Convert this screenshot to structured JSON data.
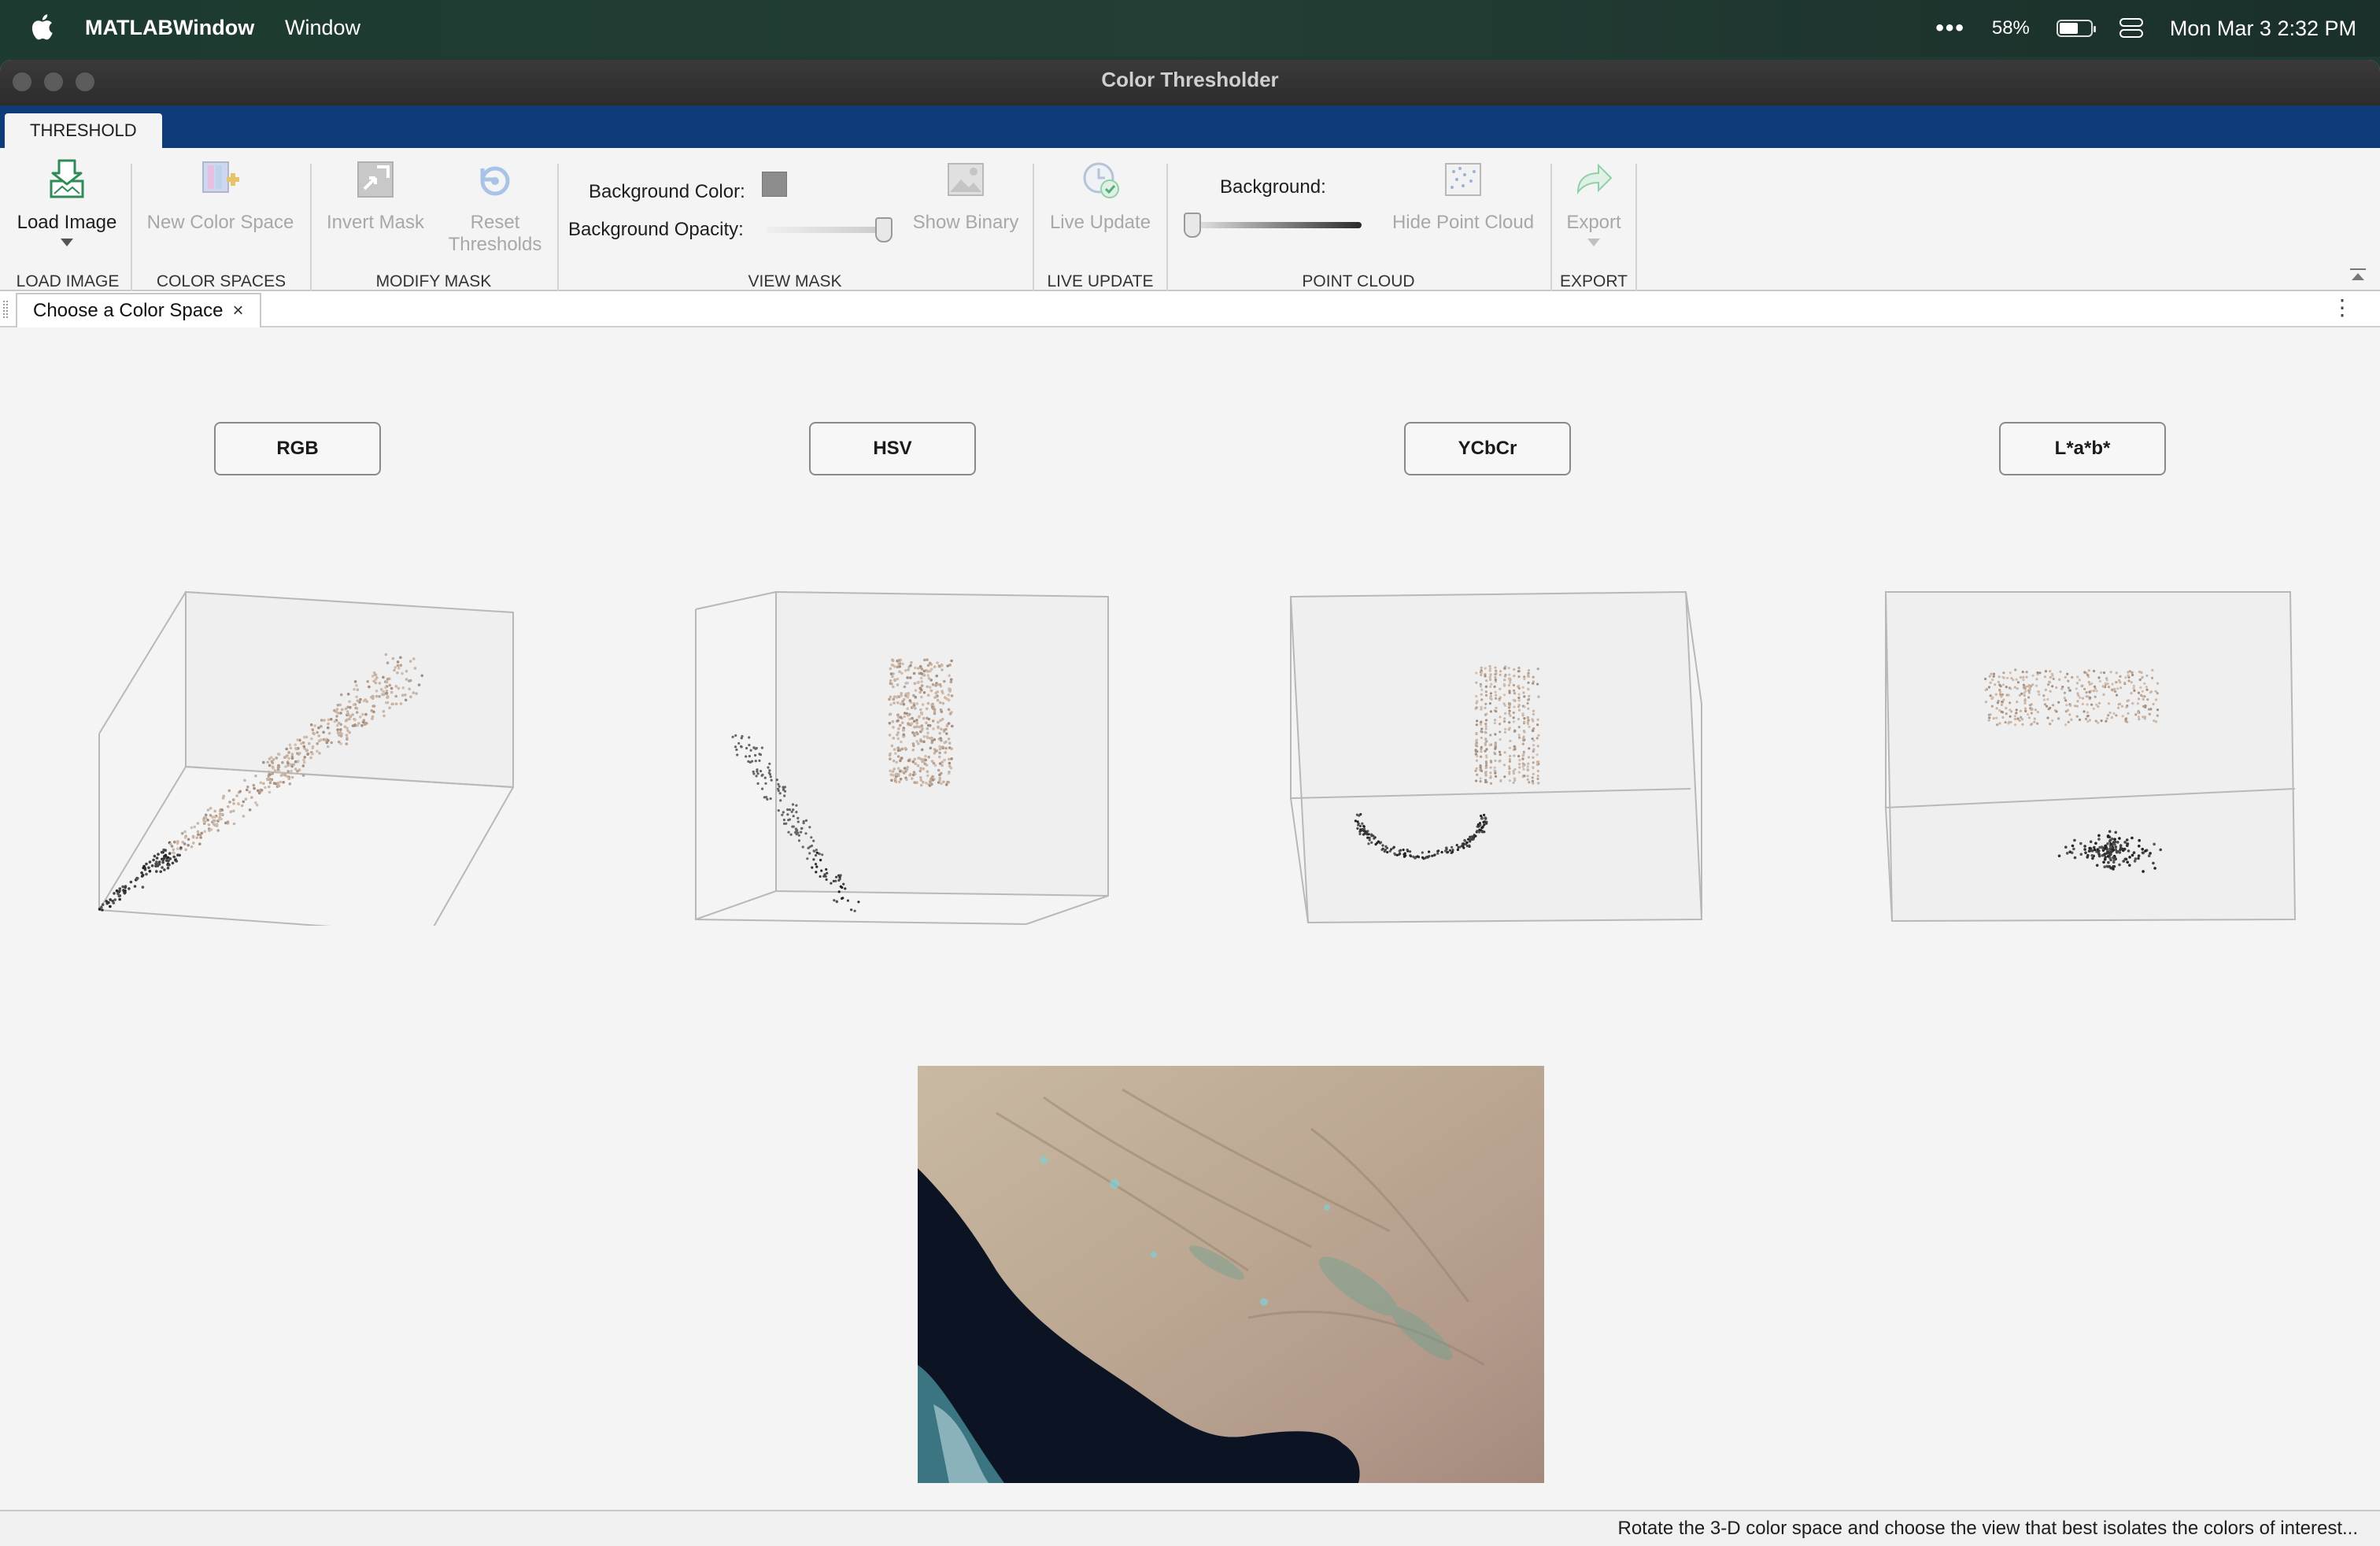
{
  "menubar": {
    "app_name": "MATLABWindow",
    "menu_window": "Window",
    "more_icon": "ellipsis-icon",
    "battery_percent": "58%",
    "datetime": "Mon Mar 3  2:32 PM"
  },
  "window": {
    "title": "Color Thresholder"
  },
  "ribbon": {
    "tab_label": "THRESHOLD",
    "load_image": {
      "label": "Load Image",
      "icon": "load-image-icon"
    },
    "new_color_space": {
      "label": "New Color Space",
      "icon": "new-color-space-icon"
    },
    "invert_mask": {
      "label": "Invert Mask",
      "icon": "invert-mask-icon"
    },
    "reset_thresholds": {
      "label_line1": "Reset",
      "label_line2": "Thresholds",
      "icon": "reset-icon"
    },
    "background_color_label": "Background Color:",
    "background_color_value": "#8c8c8c",
    "background_opacity_label": "Background Opacity:",
    "background_opacity_value": 1.0,
    "show_binary": {
      "label": "Show Binary",
      "icon": "image-icon"
    },
    "live_update": {
      "label": "Live Update",
      "icon": "clock-check-icon"
    },
    "point_cloud_background_label": "Background:",
    "point_cloud_background_value": 0.0,
    "hide_point_cloud": {
      "label": "Hide Point Cloud",
      "icon": "point-cloud-icon"
    },
    "export": {
      "label": "Export",
      "icon": "export-arrow-icon"
    },
    "groups": {
      "load_image": "LOAD IMAGE",
      "color_spaces": "COLOR SPACES",
      "modify_mask": "MODIFY MASK",
      "view_mask": "VIEW MASK",
      "live_update": "LIVE UPDATE",
      "point_cloud": "POINT CLOUD",
      "export": "EXPORT"
    }
  },
  "document": {
    "tab_label": "Choose a Color Space",
    "close_glyph": "×",
    "menu_glyph": "⋮"
  },
  "color_spaces": [
    {
      "label": "RGB"
    },
    {
      "label": "HSV"
    },
    {
      "label": "YCbCr"
    },
    {
      "label": "L*a*b*"
    }
  ],
  "status": {
    "message": "Rotate the 3-D color space and choose the view that best isolates the colors of interest..."
  },
  "colors": {
    "ribbon_tab_bar": "#0f3c78",
    "load_image_icon": "#2e8b57",
    "disabled_text": "#a8a8a8"
  }
}
